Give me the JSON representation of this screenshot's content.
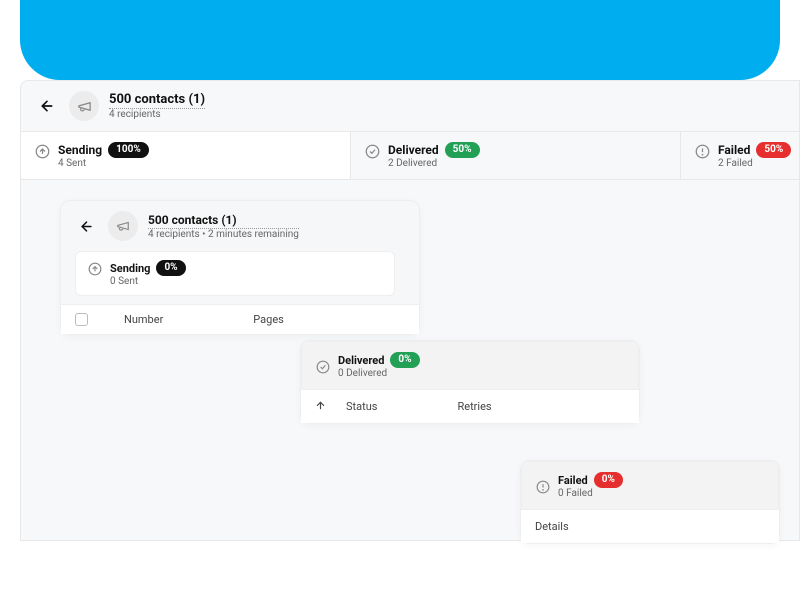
{
  "main": {
    "title": "500 contacts (1)",
    "subtitle": "4 recipients",
    "tabs": {
      "sending": {
        "label": "Sending",
        "badge": "100%",
        "sub": "4 Sent"
      },
      "delivered": {
        "label": "Delivered",
        "badge": "50%",
        "sub": "2 Delivered"
      },
      "failed": {
        "label": "Failed",
        "badge": "50%",
        "sub": "2 Failed"
      }
    }
  },
  "card1": {
    "title": "500 contacts (1)",
    "subtitle": "4 recipients • 2 minutes remaining",
    "tab": {
      "label": "Sending",
      "badge": "0%",
      "sub": "0 Sent"
    },
    "cols": {
      "number": "Number",
      "pages": "Pages"
    }
  },
  "card2": {
    "tab": {
      "label": "Delivered",
      "badge": "0%",
      "sub": "0 Delivered"
    },
    "cols": {
      "status": "Status",
      "retries": "Retries"
    }
  },
  "card3": {
    "tab": {
      "label": "Failed",
      "badge": "0%",
      "sub": "0 Failed"
    },
    "cols": {
      "details": "Details"
    }
  }
}
